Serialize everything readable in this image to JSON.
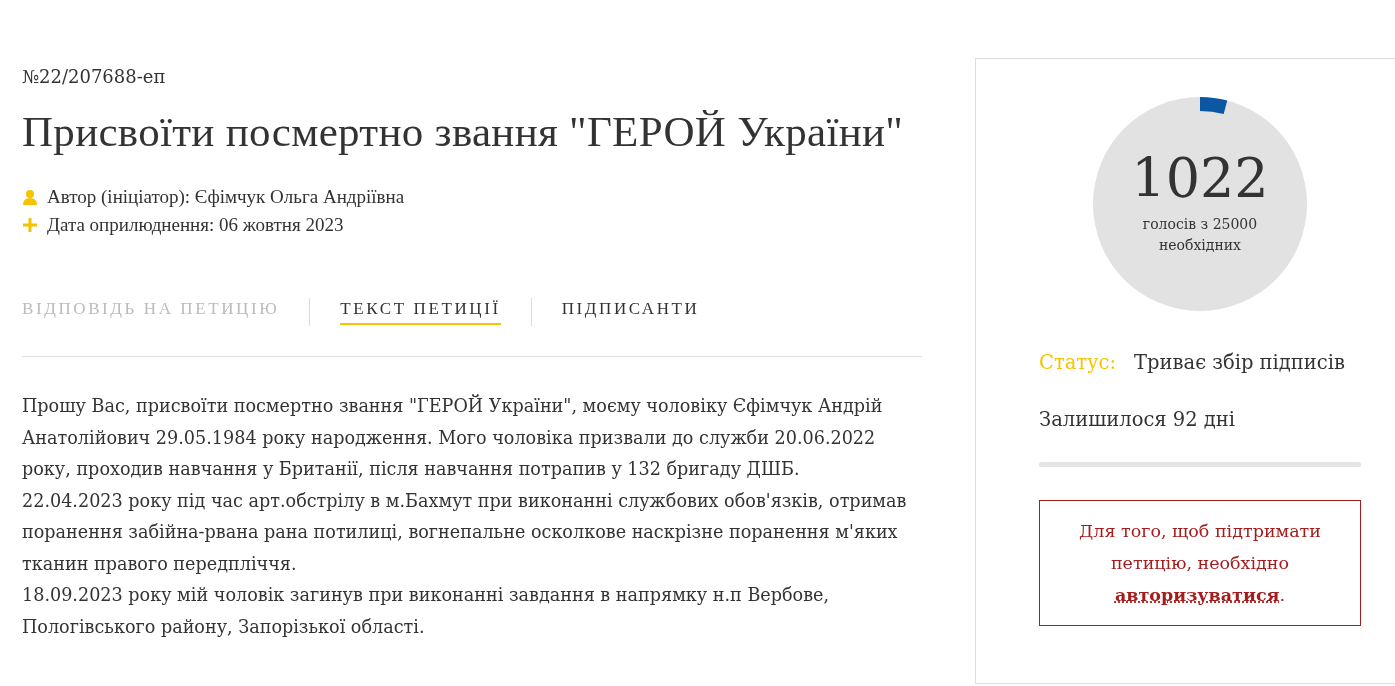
{
  "petition": {
    "number": "№22/207688-еп",
    "title": "Присвоїти посмертно звання \"ГЕРОЙ України\"",
    "meta": [
      {
        "kind": "author",
        "text": "Автор (ініціатор): Єфімчук Ольга Андріївна"
      },
      {
        "kind": "date",
        "text": "Дата оприлюднення: 06 жовтня 2023"
      }
    ]
  },
  "tabs": [
    {
      "label": "ВІДПОВІДЬ НА ПЕТИЦІЮ",
      "selected": false,
      "disabled": true
    },
    {
      "label": "ТЕКСТ ПЕТИЦІЇ",
      "selected": true,
      "disabled": false
    },
    {
      "label": "ПІДПИСАНТИ",
      "selected": false,
      "disabled": false
    }
  ],
  "body": [
    "Прошу Вас, присвоїти посмертно звання \"ГЕРОЙ України\", моєму чоловіку Єфімчук Андрій Анатолійович 29.05.1984 року народження. Мого чоловіка призвали до служби 20.06.2022 року, проходив навчання у Британії, після навчання потрапив у 132 бригаду ДШБ.",
    "22.04.2023 року під час арт.обстрілу в м.Бахмут при виконанні службових обов'язків, отримав поранення забійна-рвана рана потилиці, вогнепальне осколкове наскрізне поранення м'яких тканин правого передпліччя.",
    "18.09.2023 року мій чоловік загинув при виконанні завдання в напрямку н.п Вербове, Пологівського району, Запорізької області."
  ],
  "sidebar": {
    "votes": {
      "count": "1022",
      "caption": "голосів з 25000 необхідних"
    },
    "status_label": "Статус:",
    "status": "Триває збір підписів",
    "days_left": "Залишилося 92 дні",
    "auth_notice": {
      "text_before": "Для того, щоб підтримати петицію, необхідно",
      "link": "авторизуватися",
      "text_after": "."
    }
  }
}
